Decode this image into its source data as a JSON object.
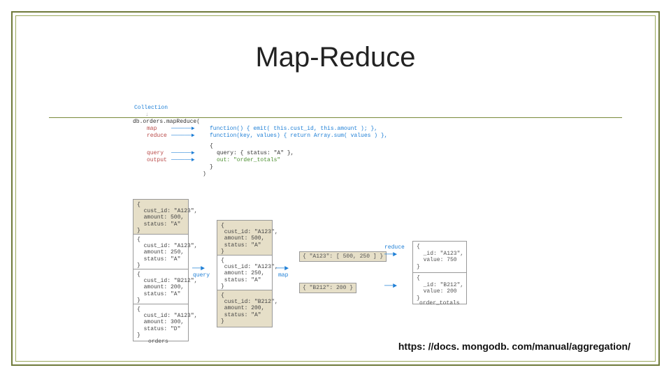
{
  "title": "Map-Reduce",
  "footer_url": "https: //docs. mongodb. com/manual/aggregation/",
  "code": {
    "collection_label": "Collection",
    "call": "db.orders.mapReduce(",
    "labels": {
      "map": "map",
      "reduce": "reduce",
      "query": "query",
      "output": "output"
    },
    "map_fn": "function() { emit( this.cust_id, this.amount ); },",
    "reduce_fn": "function(key, values) { return Array.sum( values ) },",
    "brace_open": "{",
    "query_line": "query: { status: \"A\" },",
    "out_line": "out: \"order_totals\"",
    "brace_close": "}",
    "paren_close": ")"
  },
  "orders_label": "orders",
  "orders": [
    "{\n  cust_id: \"A123\",\n  amount: 500,\n  status: \"A\"\n}",
    "{\n  cust_id: \"A123\",\n  amount: 250,\n  status: \"A\"\n}",
    "{\n  cust_id: \"B212\",\n  amount: 200,\n  status: \"A\"\n}",
    "{\n  cust_id: \"A123\",\n  amount: 300,\n  status: \"D\"\n}"
  ],
  "filtered": [
    "{\n cust_id: \"A123\",\n amount: 500,\n status: \"A\"\n}",
    "{\n cust_id: \"A123\",\n amount: 250,\n status: \"A\"\n}",
    "{\n cust_id: \"B212\",\n amount: 200,\n status: \"A\"\n}"
  ],
  "emits": [
    "{ \"A123\": [ 500, 250 ] }",
    "{ \"B212\": 200 }"
  ],
  "results_label": "order_totals",
  "results": [
    "{\n  _id: \"A123\",\n  value: 750\n}",
    "{\n  _id: \"B212\",\n  value: 200\n}"
  ],
  "stages": {
    "query": "query",
    "map": "map",
    "reduce": "reduce"
  }
}
